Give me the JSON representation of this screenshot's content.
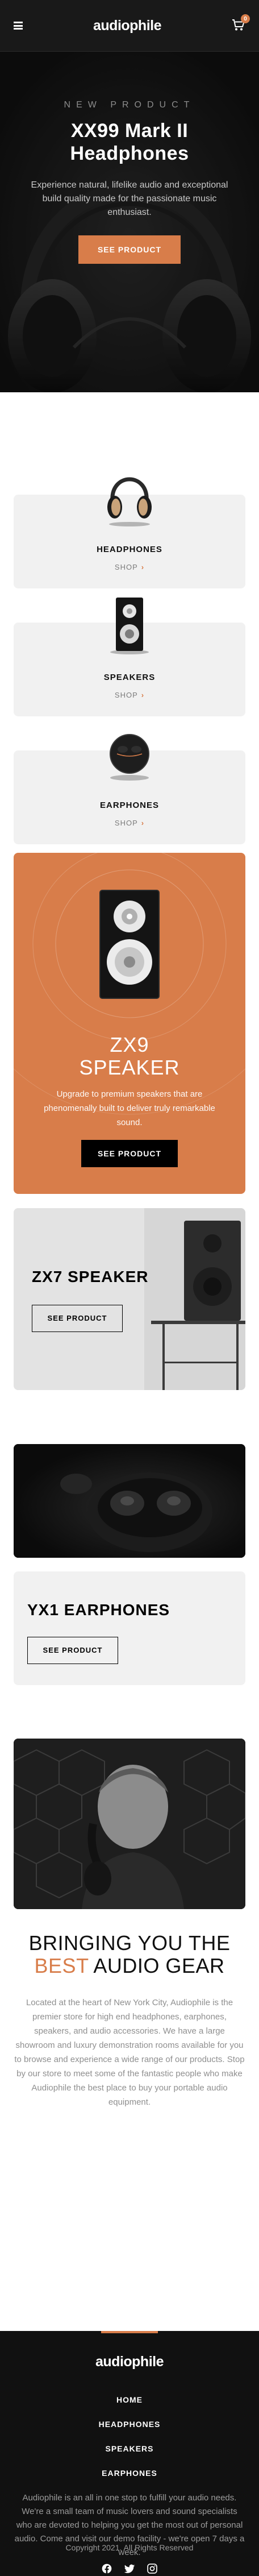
{
  "header": {
    "logo": "audiophile",
    "cart_count": "0",
    "icons": [
      "hamburger-menu-icon",
      "cart-icon"
    ]
  },
  "hero": {
    "overline": "New Product",
    "title": "XX99 Mark II Headphones",
    "description": "Experience natural, lifelike audio and exceptional build quality made for the passionate music enthusiast.",
    "cta": "See Product"
  },
  "categories": [
    {
      "title": "Headphones",
      "shop": "Shop"
    },
    {
      "title": "Speakers",
      "shop": "Shop"
    },
    {
      "title": "Earphones",
      "shop": "Shop"
    }
  ],
  "zx9": {
    "title_line1": "ZX9",
    "title_line2": "Speaker",
    "description": "Upgrade to premium speakers that are phenomenally built to deliver truly remarkable sound.",
    "cta": "See Product"
  },
  "zx7": {
    "title": "ZX7 Speaker",
    "cta": "See Product"
  },
  "yx1": {
    "title": "YX1 Earphones",
    "cta": "See Product"
  },
  "about": {
    "title_pre": "Bringing you the ",
    "title_accent": "best",
    "title_post": " audio gear",
    "text": "Located at the heart of New York City, Audiophile is the premier store for high end headphones, earphones, speakers, and audio accessories. We have a large showroom and luxury demonstration rooms available for you to browse and experience a wide range of our products. Stop by our store to meet some of the fantastic people who make Audiophile the best place to buy your portable audio equipment."
  },
  "footer": {
    "logo": "audiophile",
    "nav": [
      "Home",
      "Headphones",
      "Speakers",
      "Earphones"
    ],
    "text": "Audiophile is an all in one stop to fulfill your audio needs. We're a small team of music lovers and sound specialists who are devoted to helping you get the most out of personal audio. Come and visit our demo facility - we're open 7 days a week.",
    "copyright": "Copyright 2021. All Rights Reserved",
    "social": [
      "facebook-icon",
      "twitter-icon",
      "instagram-icon"
    ]
  },
  "colors": {
    "accent": "#D87D4A",
    "dark": "#191919",
    "light_gray": "#F1F1F1"
  }
}
